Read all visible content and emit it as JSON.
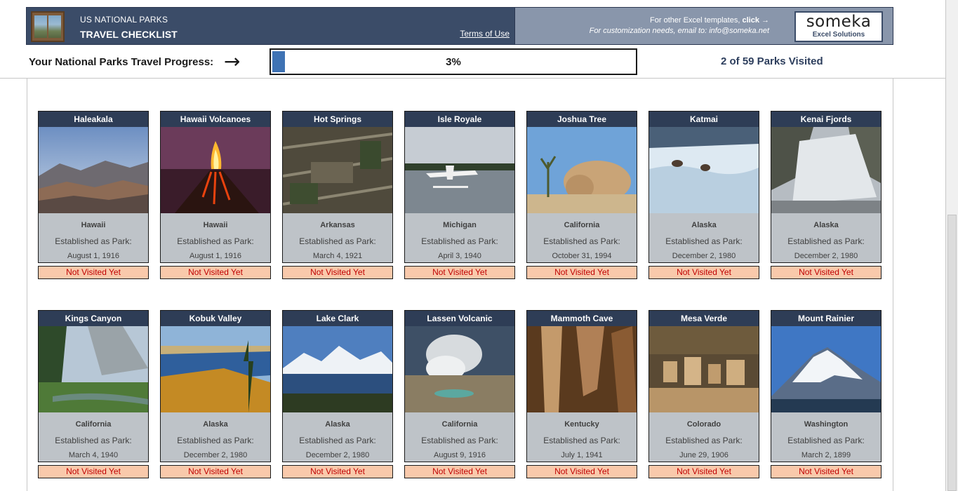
{
  "header": {
    "subtitle": "US NATIONAL PARKS",
    "title": "TRAVEL CHECKLIST",
    "terms_link": "Terms of Use",
    "promo_line1_text": "For other Excel templates, ",
    "promo_line1_link": "click",
    "promo_line1_arrow": "→",
    "promo_line2": "For customization needs, email to: info@someka.net",
    "brand_name": "someka",
    "brand_tagline": "Excel Solutions"
  },
  "progress": {
    "label": "Your National Parks Travel Progress:",
    "arrow": "→",
    "percent_text": "3%",
    "fraction": 0.034,
    "visited_text": "2 of 59 Parks Visited",
    "bar_color": "#3f73b4"
  },
  "colors": {
    "banner": "#3b4c68",
    "card_title_bg": "#2e3d56",
    "card_body_bg": "#bec3c8",
    "status_bg": "#f9c9ab",
    "status_text": "#c00000"
  },
  "card_labels": {
    "established": "Established as Park:",
    "status_not_visited": "Not Visited Yet"
  },
  "parks": [
    {
      "name": "Haleakala",
      "state": "Hawaii",
      "date": "August 1, 1916",
      "status": "Not Visited Yet",
      "photo": "mountain-valley"
    },
    {
      "name": "Hawaii Volcanoes",
      "state": "Hawaii",
      "date": "August 1, 1916",
      "status": "Not Visited Yet",
      "photo": "volcano-eruption"
    },
    {
      "name": "Hot Springs",
      "state": "Arkansas",
      "date": "March 4, 1921",
      "status": "Not Visited Yet",
      "photo": "aerial-town"
    },
    {
      "name": "Isle Royale",
      "state": "Michigan",
      "date": "April 3, 1940",
      "status": "Not Visited Yet",
      "photo": "seaplane-lake"
    },
    {
      "name": "Joshua Tree",
      "state": "California",
      "date": "October 31, 1994",
      "status": "Not Visited Yet",
      "photo": "desert-rocks"
    },
    {
      "name": "Katmai",
      "state": "Alaska",
      "date": "December 2, 1980",
      "status": "Not Visited Yet",
      "photo": "waterfall-bears"
    },
    {
      "name": "Kenai Fjords",
      "state": "Alaska",
      "date": "December 2, 1980",
      "status": "Not Visited Yet",
      "photo": "glacier"
    },
    {
      "name": "Kings Canyon",
      "state": "California",
      "date": "March 4, 1940",
      "status": "Not Visited Yet",
      "photo": "canyon-forest"
    },
    {
      "name": "Kobuk Valley",
      "state": "Alaska",
      "date": "December 2, 1980",
      "status": "Not Visited Yet",
      "photo": "autumn-river"
    },
    {
      "name": "Lake Clark",
      "state": "Alaska",
      "date": "December 2, 1980",
      "status": "Not Visited Yet",
      "photo": "snowy-lake"
    },
    {
      "name": "Lassen Volcanic",
      "state": "California",
      "date": "August 9, 1916",
      "status": "Not Visited Yet",
      "photo": "steam-vents"
    },
    {
      "name": "Mammoth Cave",
      "state": "Kentucky",
      "date": "July 1, 1941",
      "status": "Not Visited Yet",
      "photo": "cave"
    },
    {
      "name": "Mesa Verde",
      "state": "Colorado",
      "date": "June 29, 1906",
      "status": "Not Visited Yet",
      "photo": "cliff-dwellings"
    },
    {
      "name": "Mount Rainier",
      "state": "Washington",
      "date": "March 2, 1899",
      "status": "Not Visited Yet",
      "photo": "snow-mountain"
    }
  ]
}
